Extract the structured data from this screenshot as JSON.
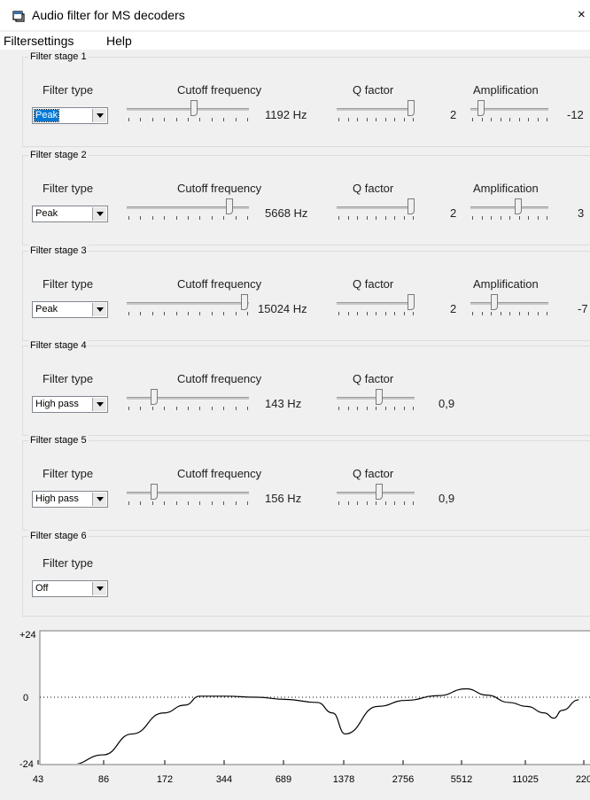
{
  "window": {
    "title": "Audio filter for MS decoders",
    "close_glyph": "×"
  },
  "menu": {
    "items": [
      "Filtersettings",
      "Help"
    ]
  },
  "column_labels": {
    "filter_type": "Filter type",
    "cutoff": "Cutoff frequency",
    "q": "Q factor",
    "amp": "Amplification"
  },
  "stages": [
    {
      "label": "Filter stage 1",
      "type": "Peak",
      "selected": true,
      "cutoff": {
        "fraction": 0.55,
        "value": "1192 Hz"
      },
      "q": {
        "fraction": 0.98,
        "value": "2"
      },
      "amp": {
        "fraction": 0.12,
        "value": "-12"
      }
    },
    {
      "label": "Filter stage 2",
      "type": "Peak",
      "selected": false,
      "cutoff": {
        "fraction": 0.85,
        "value": "5668 Hz"
      },
      "q": {
        "fraction": 0.98,
        "value": "2"
      },
      "amp": {
        "fraction": 0.62,
        "value": "3"
      }
    },
    {
      "label": "Filter stage 3",
      "type": "Peak",
      "selected": false,
      "cutoff": {
        "fraction": 0.98,
        "value": "15024 Hz"
      },
      "q": {
        "fraction": 0.98,
        "value": "2"
      },
      "amp": {
        "fraction": 0.3,
        "value": "-7"
      }
    },
    {
      "label": "Filter stage 4",
      "type": "High pass",
      "selected": false,
      "cutoff": {
        "fraction": 0.22,
        "value": "143 Hz"
      },
      "q": {
        "fraction": 0.55,
        "value": "0,9"
      }
    },
    {
      "label": "Filter stage 5",
      "type": "High pass",
      "selected": false,
      "cutoff": {
        "fraction": 0.22,
        "value": "156 Hz"
      },
      "q": {
        "fraction": 0.55,
        "value": "0,9"
      }
    },
    {
      "label": "Filter stage 6",
      "type": "Off",
      "selected": false
    }
  ],
  "chart_data": {
    "type": "line",
    "x": [
      43,
      60,
      86,
      120,
      172,
      220,
      260,
      344,
      500,
      689,
      1000,
      1192,
      1378,
      2000,
      2756,
      4000,
      5512,
      7000,
      9000,
      11025,
      13500,
      15024,
      16500,
      20000
    ],
    "y": [
      -32,
      -26,
      -22,
      -14,
      -6,
      -3,
      0.4,
      0.4,
      0,
      -0.8,
      -2,
      -6,
      -14,
      -3.5,
      -1.2,
      0.6,
      3.2,
      0.8,
      -2,
      -3.5,
      -6,
      -8,
      -5,
      -1
    ],
    "x_tick_labels": [
      "43",
      "86",
      "172",
      "344",
      "689",
      "1378",
      "2756",
      "5512",
      "11025",
      "220"
    ],
    "y_tick_labels": [
      "+24",
      "0",
      "-24"
    ],
    "ylim": [
      -24,
      24
    ],
    "x_scale": "log"
  }
}
